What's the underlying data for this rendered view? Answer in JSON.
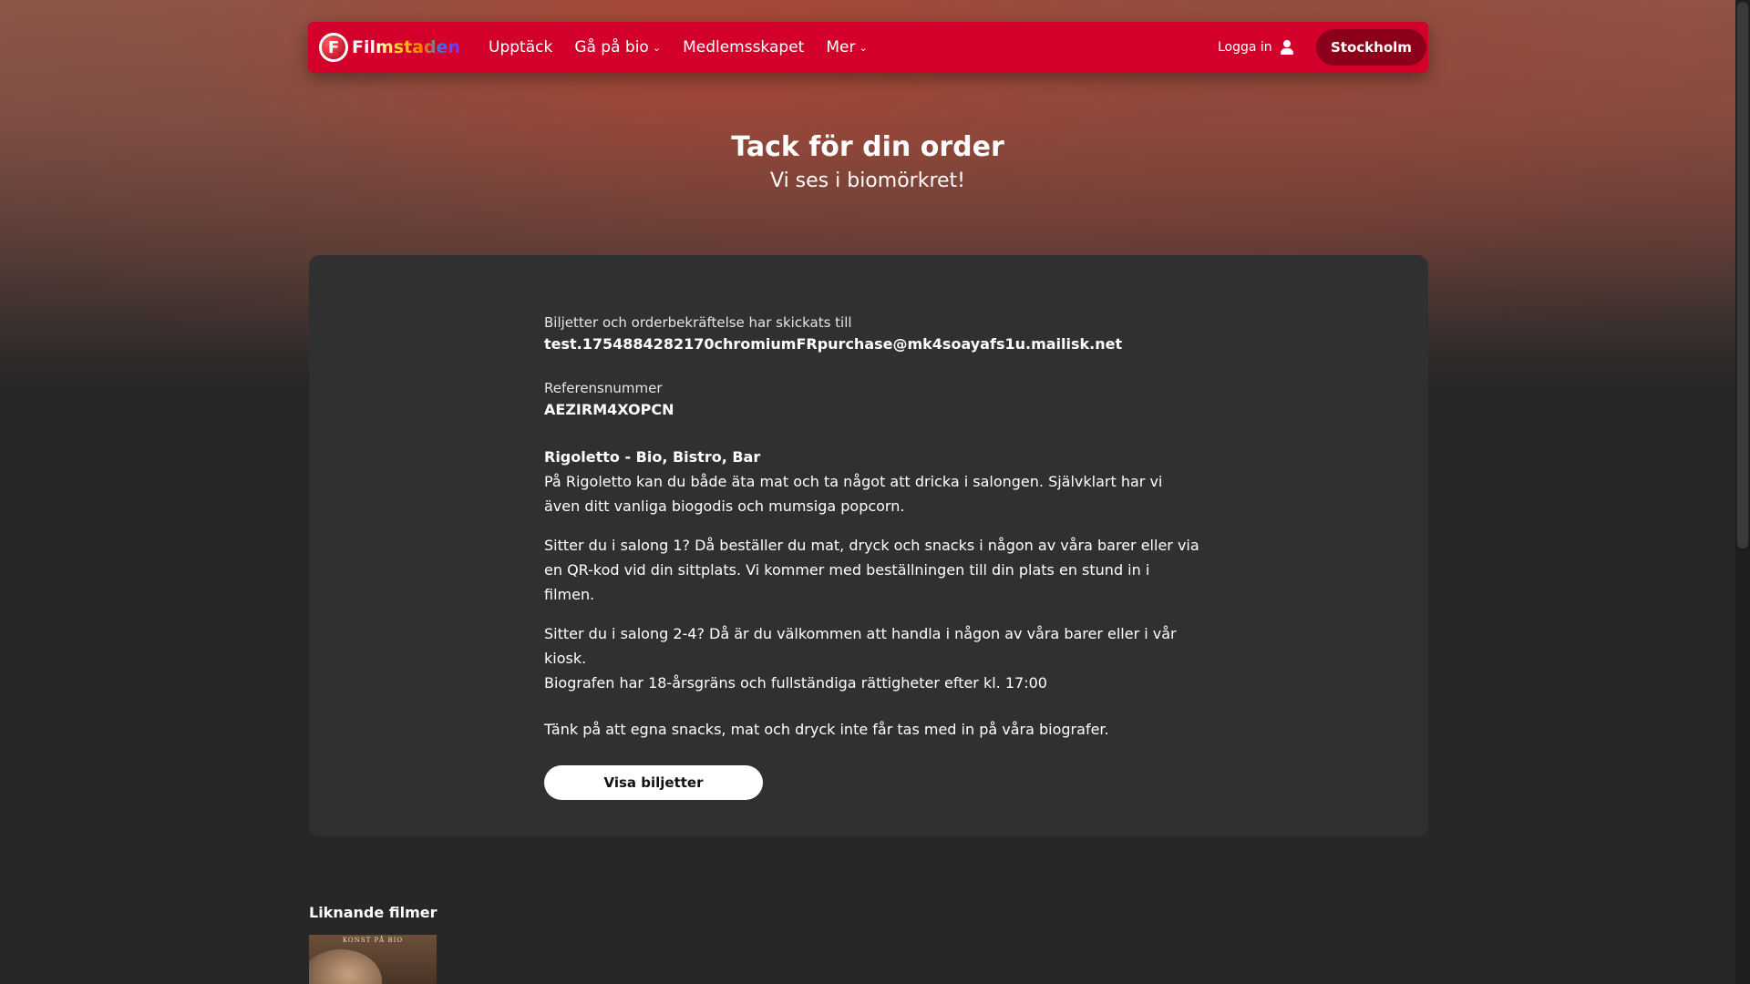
{
  "header": {
    "logo_text": "Filmstaden",
    "nav": [
      {
        "label": "Upptäck",
        "has_dropdown": false
      },
      {
        "label": "Gå på bio",
        "has_dropdown": true
      },
      {
        "label": "Medlemsskapet",
        "has_dropdown": false
      },
      {
        "label": "Mer",
        "has_dropdown": true
      }
    ],
    "login_label": "Logga in",
    "city_label": "Stockholm",
    "brand_color": "#d2002b"
  },
  "page": {
    "title": "Tack för din order",
    "subtitle": "Vi ses i biomörkret!"
  },
  "order": {
    "sent_to_label": "Biljetter och orderbekräftelse har skickats till",
    "email": "test.1754884282170chromiumFRpurchase@mk4soayafs1u.mailisk.net",
    "reference_label": "Referensnummer",
    "reference": "AEZIRM4XOPCN",
    "venue_title": "Rigoletto - Bio, Bistro, Bar",
    "venue_p1": "På Rigoletto kan du både äta mat och ta något att dricka i salongen. Självklart har vi även ditt vanliga biogodis och mumsiga popcorn.",
    "venue_p2": "Sitter du i salong 1? Då beställer du mat, dryck och snacks i någon av våra barer eller via en QR-kod vid din sittplats. Vi kommer med beställningen till din plats en stund in i filmen.",
    "venue_p3": "Sitter du i salong 2-4? Då är du välkommen att handla i någon av våra barer eller i vår kiosk.",
    "venue_p4": "Biografen har 18-årsgräns och fullständiga rättigheter efter kl. 17:00",
    "notice": "Tänk på att egna snacks, mat och dryck inte får tas med in på våra biografer.",
    "button_label": "Visa biljetter"
  },
  "similar": {
    "heading": "Liknande filmer",
    "poster_text": "KONST PÅ BIO"
  }
}
